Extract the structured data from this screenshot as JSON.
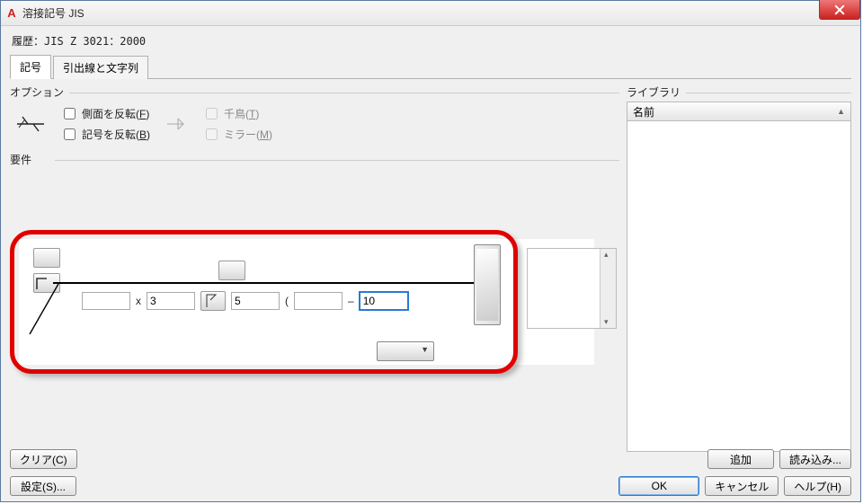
{
  "window": {
    "title": "溶接記号 JIS"
  },
  "history": {
    "label": "履歴：JIS Z 3021：2000"
  },
  "tabs": {
    "tab1": "記号",
    "tab2": "引出線と文字列"
  },
  "options": {
    "group_label": "オプション",
    "flip_side": "側面を反転(",
    "flip_side_u": "F",
    "flip_side_end": ")",
    "flip_symbol": "記号を反転(",
    "flip_symbol_u": "B",
    "flip_symbol_end": ")",
    "chidori": "千鳥(",
    "chidori_u": "T",
    "chidori_end": ")",
    "mirror": "ミラー(",
    "mirror_u": "M",
    "mirror_end": ")"
  },
  "requirements": {
    "label": "要件"
  },
  "weld_params": {
    "input_a": "",
    "x_label": "x",
    "input_b": "3",
    "input_c": "5",
    "paren_open": "(",
    "input_d": "",
    "dash": "–",
    "input_e": "10"
  },
  "library": {
    "label": "ライブラリ",
    "col_name": "名前"
  },
  "buttons": {
    "clear": "クリア(C)",
    "add": "追加",
    "load": "読み込み...",
    "settings": "設定(S)...",
    "ok": "OK",
    "cancel": "キャンセル",
    "help": "ヘルプ(H)"
  }
}
